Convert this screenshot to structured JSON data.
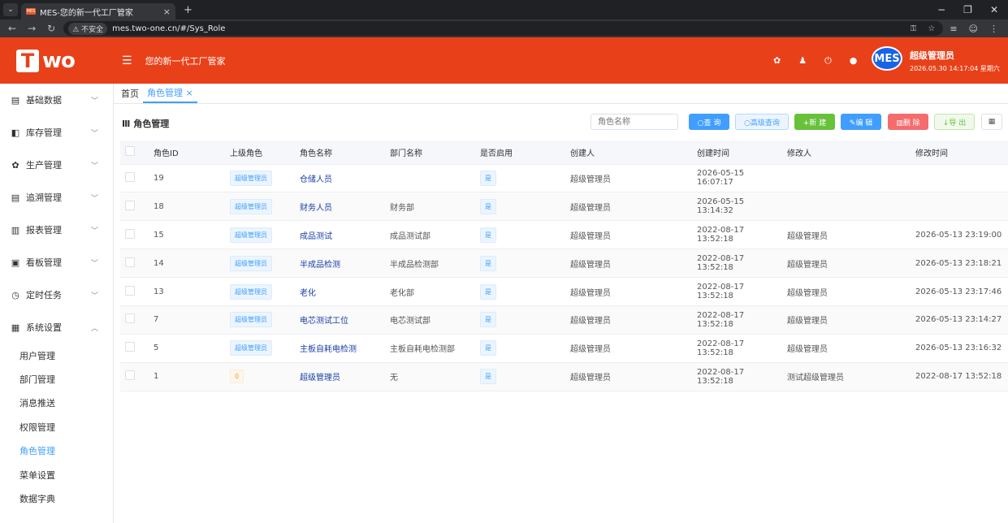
{
  "browser": {
    "tab_title": "MES-您的新一代工厂管家",
    "tab_close": "×",
    "new_tab": "+",
    "insecure": "⚠ 不安全",
    "url": "mes.two-one.cn/#/Sys_Role"
  },
  "app": {
    "logo_t": "T",
    "logo_rest": "wo",
    "title": "您的新一代工厂管家",
    "avatar": "MES",
    "username": "超级管理员",
    "datetime": "2026.05.30 14:17:04 星期六"
  },
  "sidebar": {
    "items": [
      {
        "icon": "▤",
        "label": "基础数据",
        "arrow": "﹀"
      },
      {
        "icon": "◧",
        "label": "库存管理",
        "arrow": "﹀"
      },
      {
        "icon": "✿",
        "label": "生产管理",
        "arrow": "﹀"
      },
      {
        "icon": "▤",
        "label": "追溯管理",
        "arrow": "﹀"
      },
      {
        "icon": "▥",
        "label": "报表管理",
        "arrow": "﹀"
      },
      {
        "icon": "▣",
        "label": "看板管理",
        "arrow": "﹀"
      },
      {
        "icon": "◷",
        "label": "定时任务",
        "arrow": "﹀"
      },
      {
        "icon": "▦",
        "label": "系统设置",
        "arrow": "︿"
      }
    ],
    "subitems": [
      "用户管理",
      "部门管理",
      "消息推送",
      "权限管理",
      "角色管理",
      "菜单设置",
      "数据字典"
    ]
  },
  "tabs": {
    "home": "首页",
    "current": "角色管理 ×"
  },
  "toolbar": {
    "title": "Ⅲ 角色管理",
    "search_placeholder": "角色名称",
    "query": "○查 询",
    "advanced": "○高级查询",
    "add": "+新 建",
    "edit": "✎编 辑",
    "delete": "▥删 除",
    "export": "↓导 出",
    "columns": "▦"
  },
  "table": {
    "headers": [
      "角色ID",
      "上级角色",
      "角色名称",
      "部门名称",
      "是否启用",
      "创建人",
      "创建时间",
      "修改人",
      "修改时间"
    ],
    "rows": [
      [
        "19",
        "超级管理员",
        "仓储人员",
        "",
        "是",
        "超级管理员",
        "2026-05-15 16:07:17",
        "",
        ""
      ],
      [
        "18",
        "超级管理员",
        "财务人员",
        "财务部",
        "是",
        "超级管理员",
        "2026-05-15 13:14:32",
        "",
        ""
      ],
      [
        "15",
        "超级管理员",
        "成品测试",
        "成品测试部",
        "是",
        "超级管理员",
        "2022-08-17 13:52:18",
        "超级管理员",
        "2026-05-13 23:19:00"
      ],
      [
        "14",
        "超级管理员",
        "半成品检测",
        "半成品检测部",
        "是",
        "超级管理员",
        "2022-08-17 13:52:18",
        "超级管理员",
        "2026-05-13 23:18:21"
      ],
      [
        "13",
        "超级管理员",
        "老化",
        "老化部",
        "是",
        "超级管理员",
        "2022-08-17 13:52:18",
        "超级管理员",
        "2026-05-13 23:17:46"
      ],
      [
        "7",
        "超级管理员",
        "电芯测试工位",
        "电芯测试部",
        "是",
        "超级管理员",
        "2022-08-17 13:52:18",
        "超级管理员",
        "2026-05-13 23:14:27"
      ],
      [
        "5",
        "超级管理员",
        "主板自耗电检测",
        "主板自耗电检测部",
        "是",
        "超级管理员",
        "2022-08-17 13:52:18",
        "超级管理员",
        "2026-05-13 23:16:32"
      ],
      [
        "1",
        "0",
        "超级管理员",
        "无",
        "是",
        "超级管理员",
        "2022-08-17 13:52:18",
        "测试超级管理员",
        "2022-08-17 13:52:18"
      ]
    ]
  },
  "colors": {
    "header": "#e8411a",
    "primary": "#409eff",
    "success": "#67c23a",
    "danger": "#f56c6c"
  }
}
